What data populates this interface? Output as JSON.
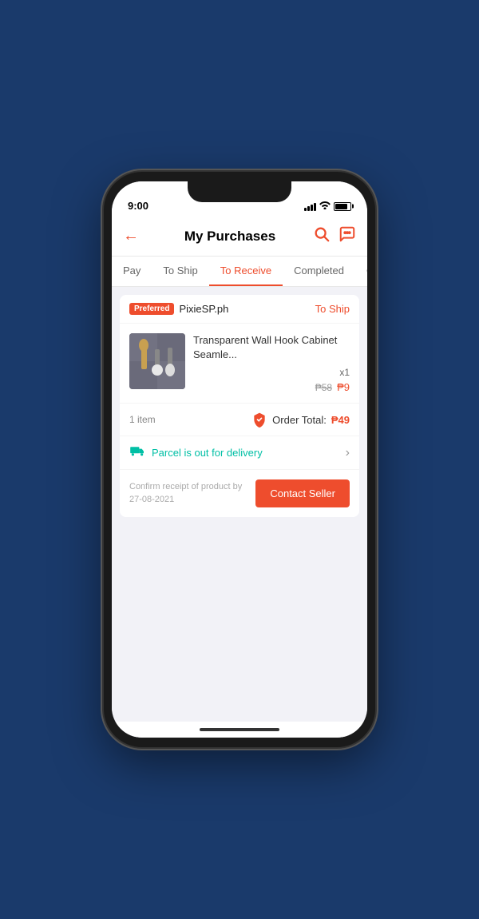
{
  "status_bar": {
    "time": "9:00"
  },
  "header": {
    "title": "My Purchases",
    "back_label": "←",
    "search_icon": "search",
    "chat_icon": "chat"
  },
  "tabs": [
    {
      "label": "Pay",
      "active": false
    },
    {
      "label": "To Ship",
      "active": false
    },
    {
      "label": "To Receive",
      "active": true
    },
    {
      "label": "Completed",
      "active": false
    },
    {
      "label": "Ca",
      "active": false
    }
  ],
  "order": {
    "preferred_badge": "Preferred",
    "seller_name": "PixieSP.ph",
    "status": "To Ship",
    "product_name": "Transparent Wall Hook Cabinet Seamle...",
    "quantity": "x1",
    "price_original": "₱58",
    "price_sale": "₱9",
    "items_count": "1 item",
    "order_total_label": "Order Total:",
    "order_total_amount": "₱49",
    "delivery_message": "Parcel is out for delivery",
    "confirm_text": "Confirm receipt of product by 27-08-2021",
    "contact_seller_btn": "Contact Seller"
  },
  "colors": {
    "primary": "#ee4d2d",
    "teal": "#00bfa5"
  }
}
